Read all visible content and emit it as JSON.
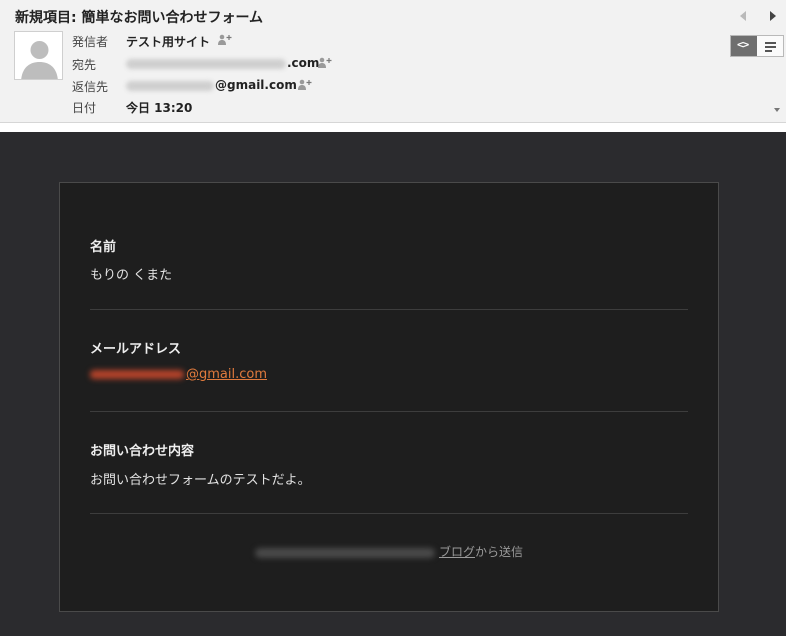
{
  "header": {
    "subject": "新規項目: 簡単なお問い合わせフォーム",
    "from_label": "発信者",
    "from_value": "テスト用サイト",
    "to_label": "宛先",
    "to_suffix": ".com",
    "reply_label": "返信先",
    "reply_suffix": "@gmail.com",
    "date_label": "日付",
    "date_value": "今日 13:20",
    "view_html_glyph": "<>",
    "icons": {
      "avatar": "person-silhouette-icon",
      "add_contact": "add-contact-icon",
      "prev": "chevron-left-icon",
      "next": "chevron-right-icon",
      "view_html": "code-view-icon",
      "view_plain": "plain-text-icon",
      "scroll": "chevron-down-icon"
    }
  },
  "form": {
    "fields": [
      {
        "label": "名前",
        "value": "もりの くまた"
      },
      {
        "label": "メールアドレス",
        "value": "@gmail.com"
      },
      {
        "label": "お問い合わせ内容",
        "value": "お問い合わせフォームのテストだよ。"
      }
    ],
    "footer_link": "ブログ",
    "footer_suffix": "から送信"
  },
  "colors": {
    "header_bg": "#f2f2f2",
    "body_bg": "#2b2b2e",
    "card_bg": "#1e1e1e",
    "link_accent": "#e07a3d"
  }
}
